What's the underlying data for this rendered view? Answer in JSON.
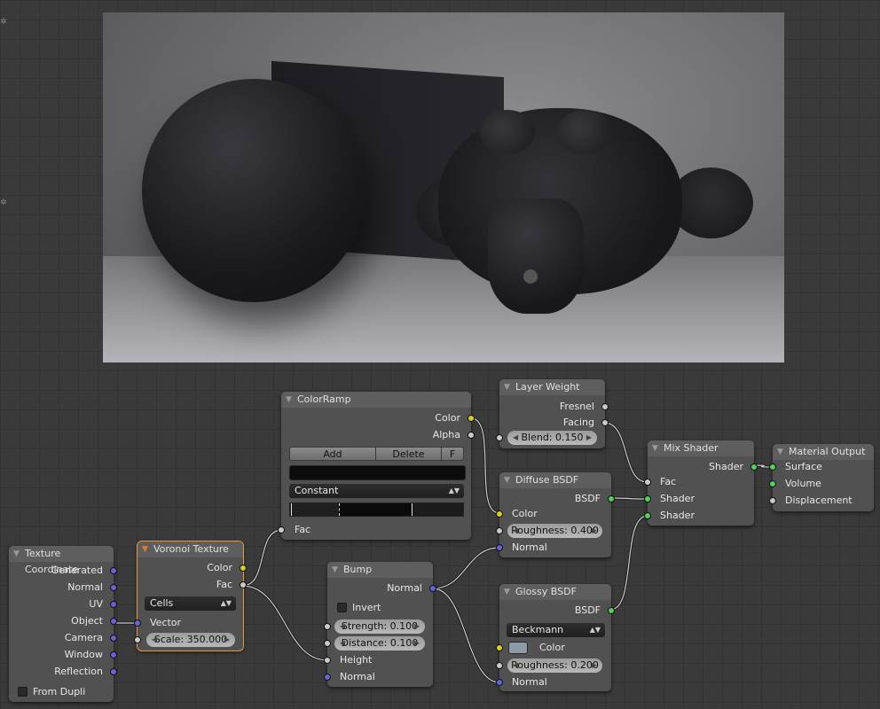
{
  "nodes": {
    "texture_coordinate": {
      "title": "Texture Coordinate",
      "outputs": [
        "Generated",
        "Normal",
        "UV",
        "Object",
        "Camera",
        "Window",
        "Reflection"
      ],
      "from_dupli": "From Dupli"
    },
    "voronoi": {
      "title": "Voronoi Texture",
      "out_color": "Color",
      "out_fac": "Fac",
      "coloring": "Cells",
      "in_vector": "Vector",
      "scale": "Scale: 350.000"
    },
    "colorramp": {
      "title": "ColorRamp",
      "out_color": "Color",
      "out_alpha": "Alpha",
      "add": "Add",
      "delete": "Delete",
      "flip": "F",
      "interpolation": "Constant",
      "in_fac": "Fac"
    },
    "bump": {
      "title": "Bump",
      "out_normal": "Normal",
      "invert": "Invert",
      "strength": "Strength: 0.100",
      "distance": "Distance: 0.100",
      "in_height": "Height",
      "in_normal": "Normal"
    },
    "layer_weight": {
      "title": "Layer Weight",
      "out_fresnel": "Fresnel",
      "out_facing": "Facing",
      "blend": "Blend: 0.150"
    },
    "diffuse": {
      "title": "Diffuse BSDF",
      "out_bsdf": "BSDF",
      "in_color": "Color",
      "roughness": "Roughness: 0.400",
      "in_normal": "Normal"
    },
    "glossy": {
      "title": "Glossy BSDF",
      "out_bsdf": "BSDF",
      "distribution": "Beckmann",
      "in_color": "Color",
      "roughness": "Roughness: 0.200",
      "in_normal": "Normal"
    },
    "mix_shader": {
      "title": "Mix Shader",
      "out_shader": "Shader",
      "in_fac": "Fac",
      "in_shader1": "Shader",
      "in_shader2": "Shader"
    },
    "material_output": {
      "title": "Material Output",
      "in_surface": "Surface",
      "in_volume": "Volume",
      "in_displacement": "Displacement"
    }
  },
  "colors": {
    "socket_color": "#d8d020",
    "socket_float": "#cacaca",
    "socket_vector": "#6464d8",
    "socket_shader": "#52d05a",
    "active_outline": "#e89a3a"
  }
}
